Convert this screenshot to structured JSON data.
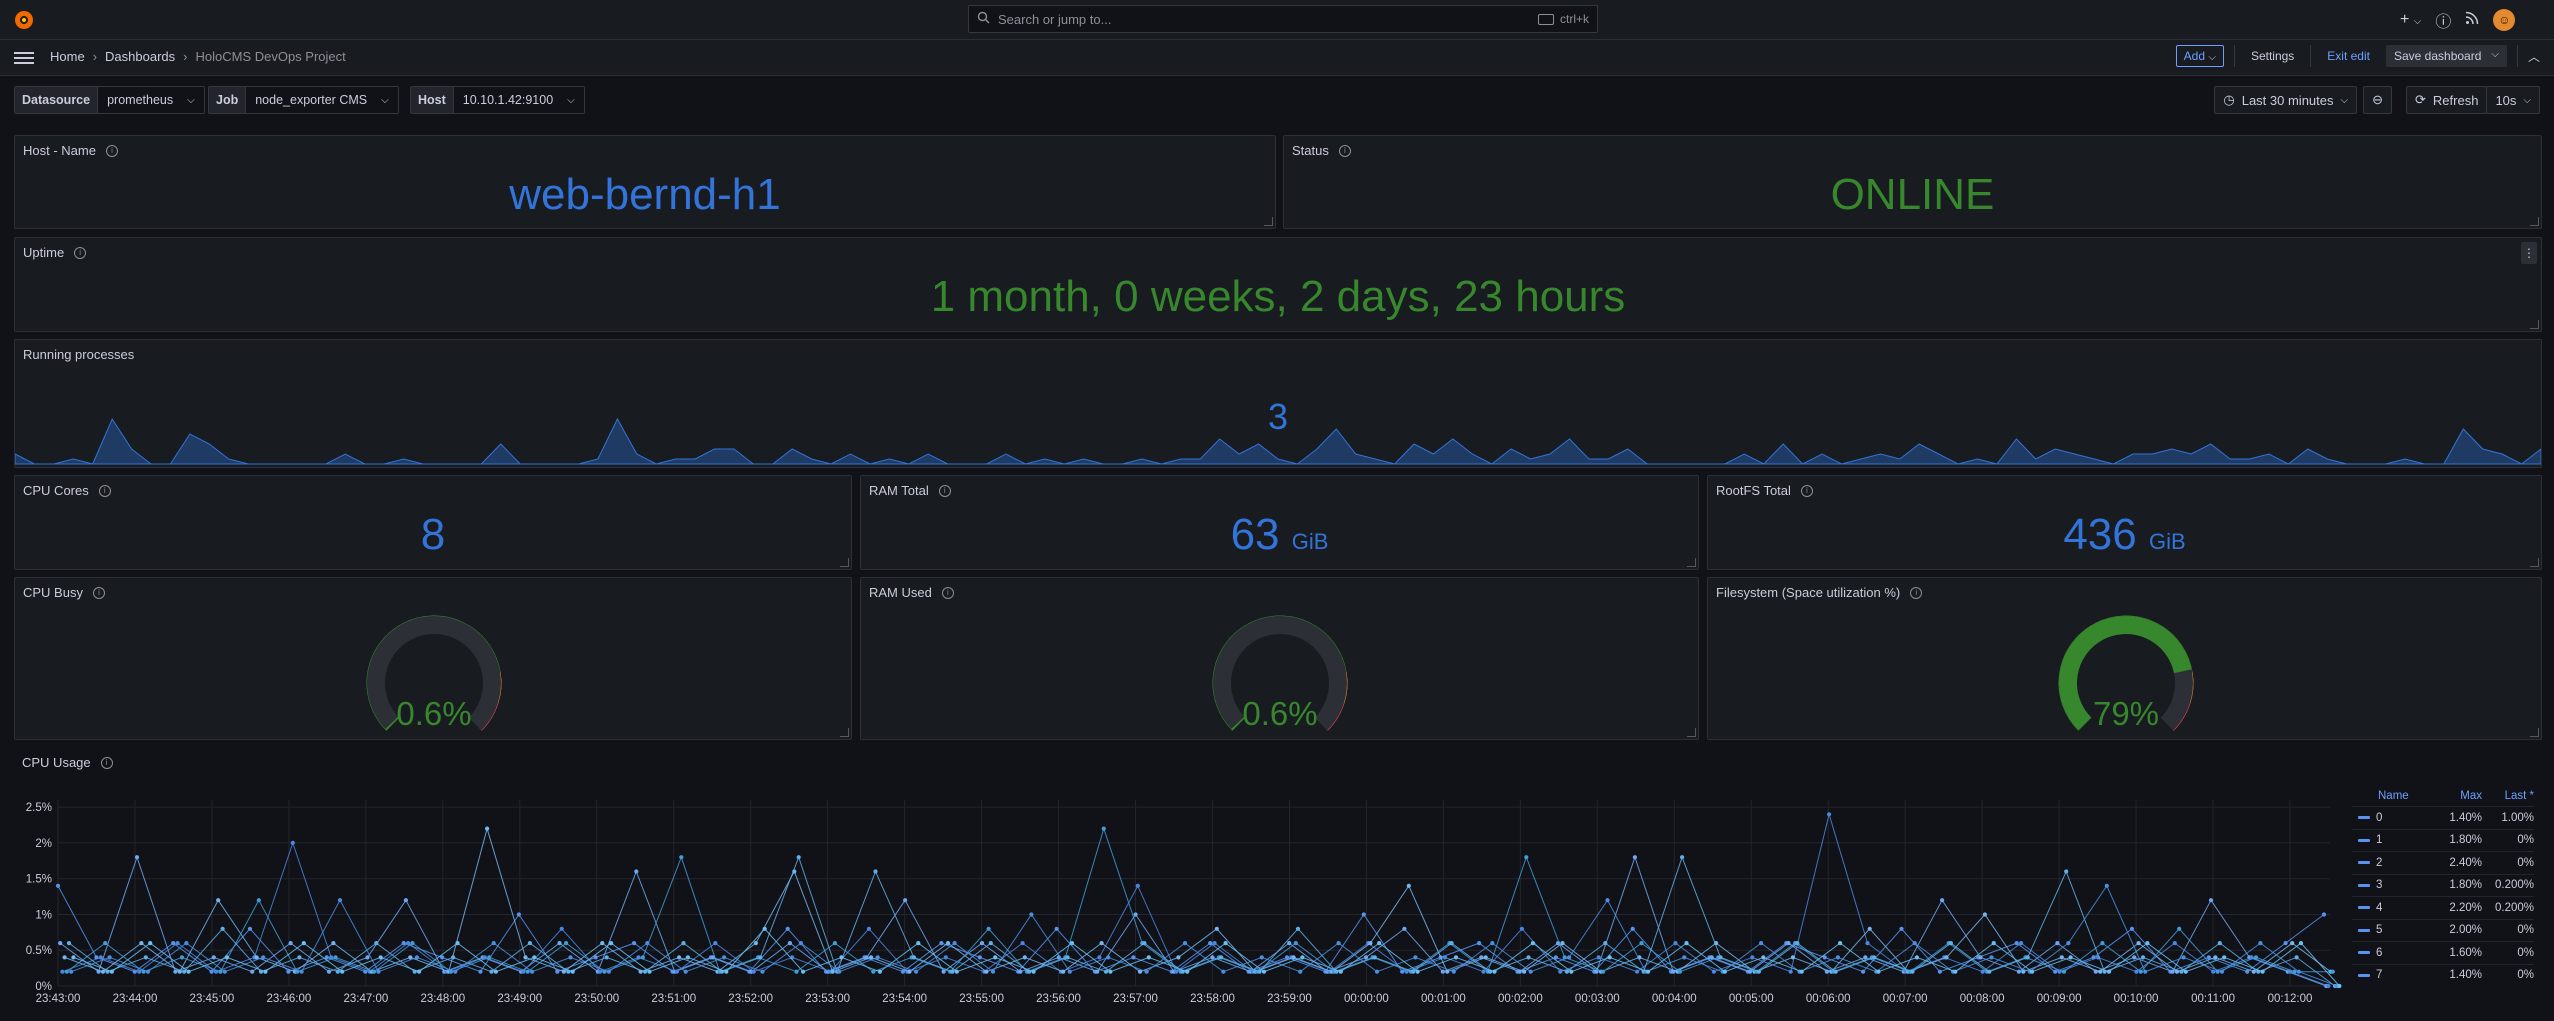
{
  "topbar": {
    "search_placeholder": "Search or jump to...",
    "search_shortcut": "ctrl+k",
    "plus_label": "+",
    "user_initial": "☺"
  },
  "breadcrumb": {
    "home": "Home",
    "dashboards": "Dashboards",
    "current": "HoloCMS DevOps Project"
  },
  "actions": {
    "add": "Add",
    "settings": "Settings",
    "exit_edit": "Exit edit",
    "save": "Save dashboard"
  },
  "variables": [
    {
      "label": "Datasource",
      "value": "prometheus"
    },
    {
      "label": "Job",
      "value": "node_exporter CMS"
    },
    {
      "label": "Host",
      "value": "10.10.1.42:9100"
    }
  ],
  "time": {
    "range": "Last 30 minutes",
    "refresh": "Refresh",
    "interval": "10s"
  },
  "panels": {
    "hostname": {
      "title": "Host - Name",
      "value": "web-bernd-h1"
    },
    "status": {
      "title": "Status",
      "value": "ONLINE"
    },
    "uptime": {
      "title": "Uptime",
      "value": "1 month, 0 weeks, 2 days, 23 hours"
    },
    "processes": {
      "title": "Running processes",
      "value": "3",
      "sparkline": [
        0.2,
        0,
        0,
        0.1,
        0,
        0.9,
        0.3,
        0,
        0,
        0.6,
        0.4,
        0.1,
        0,
        0,
        0,
        0,
        0,
        0.2,
        0,
        0,
        0.1,
        0,
        0,
        0,
        0,
        0.4,
        0,
        0,
        0,
        0,
        0.1,
        0.9,
        0.2,
        0,
        0.1,
        0.1,
        0.3,
        0.3,
        0,
        0,
        0.3,
        0.1,
        0,
        0.2,
        0,
        0.1,
        0,
        0.2,
        0,
        0,
        0,
        0.2,
        0,
        0.1,
        0,
        0.1,
        0,
        0,
        0.1,
        0,
        0.1,
        0.1,
        0.5,
        0.2,
        0.4,
        0.1,
        0,
        0.3,
        0.7,
        0.2,
        0.1,
        0,
        0.4,
        0.2,
        0.5,
        0.2,
        0,
        0.3,
        0.1,
        0.2,
        0.5,
        0.1,
        0.1,
        0.3,
        0,
        0,
        0,
        0,
        0,
        0.2,
        0,
        0.4,
        0,
        0.2,
        0,
        0.1,
        0.2,
        0.1,
        0.4,
        0.2,
        0,
        0.1,
        0,
        0.5,
        0.1,
        0.3,
        0.2,
        0.1,
        0,
        0.2,
        0.2,
        0.3,
        0.2,
        0.4,
        0.1,
        0.1,
        0.2,
        0,
        0.3,
        0.1,
        0,
        0,
        0,
        0.1,
        0,
        0,
        0.7,
        0.3,
        0.2,
        0,
        0.3
      ]
    },
    "cpu_cores": {
      "title": "CPU Cores",
      "value": "8",
      "unit": ""
    },
    "ram_total": {
      "title": "RAM Total",
      "value": "63",
      "unit": "GiB"
    },
    "rootfs_total": {
      "title": "RootFS Total",
      "value": "436",
      "unit": "GiB"
    },
    "cpu_busy": {
      "title": "CPU Busy",
      "value": "0.6%",
      "percent": 0.6
    },
    "ram_used": {
      "title": "RAM Used",
      "value": "0.6%",
      "percent": 0.6
    },
    "fs_used": {
      "title": "Filesystem (Space utilization %)",
      "value": "79%",
      "percent": 79
    },
    "cpu_usage": {
      "title": "CPU Usage"
    }
  },
  "colors": {
    "accent": "#6e9fff",
    "stat_blue": "#3274d9",
    "stat_green": "#37872d",
    "gauge_green": "#37872d",
    "gauge_orange": "#ff9830",
    "gauge_red": "#f2495c",
    "series": "#5794f2"
  },
  "chart_data": {
    "type": "line",
    "title": "CPU Usage",
    "ylim": [
      0,
      2.6
    ],
    "y_ticks": [
      "0%",
      "0.5%",
      "1%",
      "1.5%",
      "2%",
      "2.5%"
    ],
    "x_ticks": [
      "23:43:00",
      "23:44:00",
      "23:45:00",
      "23:46:00",
      "23:47:00",
      "23:48:00",
      "23:49:00",
      "23:50:00",
      "23:51:00",
      "23:52:00",
      "23:53:00",
      "23:54:00",
      "23:55:00",
      "23:56:00",
      "23:57:00",
      "23:58:00",
      "23:59:00",
      "00:00:00",
      "00:01:00",
      "00:02:00",
      "00:03:00",
      "00:04:00",
      "00:05:00",
      "00:06:00",
      "00:07:00",
      "00:08:00",
      "00:09:00",
      "00:10:00",
      "00:11:00",
      "00:12:00"
    ],
    "grid": true,
    "legend_placement": "right",
    "legend": {
      "headers": [
        "Name",
        "Max",
        "Last *"
      ],
      "rows": [
        {
          "name": "0",
          "max": "1.40%",
          "last": "1.00%"
        },
        {
          "name": "1",
          "max": "1.80%",
          "last": "0%"
        },
        {
          "name": "2",
          "max": "2.40%",
          "last": "0%"
        },
        {
          "name": "3",
          "max": "1.80%",
          "last": "0.200%"
        },
        {
          "name": "4",
          "max": "2.20%",
          "last": "0.200%"
        },
        {
          "name": "5",
          "max": "2.00%",
          "last": "0%"
        },
        {
          "name": "6",
          "max": "1.60%",
          "last": "0%"
        },
        {
          "name": "7",
          "max": "1.40%",
          "last": "0%"
        }
      ]
    },
    "series": [
      {
        "name": "0",
        "values": [
          1.4,
          0.4,
          0.2,
          0.6,
          0.2,
          0.8,
          0.2,
          0.4,
          0.2,
          0.6,
          0.4,
          0.2,
          1.0,
          0.2,
          0.4,
          0.6,
          0.2,
          0.4,
          0.2,
          0.8,
          0.2,
          0.4,
          0.2,
          0.6,
          0.4,
          0.2,
          0.8,
          0.2,
          0.4,
          0.2,
          0.6,
          0.2,
          0.4,
          0.2,
          1.0,
          0.2,
          0.4,
          0.6,
          0.2,
          0.4,
          0.2,
          0.8,
          0.2,
          0.4,
          0.2,
          0.6,
          0.4,
          0.2,
          0.8,
          0.2,
          0.4,
          0.6,
          0.2,
          0.4,
          0.8,
          0.2,
          0.4,
          0.2,
          0.6,
          1.0
        ]
      },
      {
        "name": "1",
        "values": [
          0.6,
          0.2,
          1.8,
          0.2,
          0.4,
          0.2,
          0.6,
          0.2,
          0.4,
          1.2,
          0.2,
          0.4,
          0.2,
          0.6,
          0.2,
          1.6,
          0.2,
          0.4,
          0.2,
          0.6,
          0.2,
          0.4,
          1.2,
          0.2,
          0.6,
          0.2,
          0.4,
          0.2,
          1.0,
          0.2,
          0.4,
          0.2,
          0.6,
          0.2,
          0.4,
          0.8,
          0.2,
          0.4,
          0.2,
          0.6,
          0.2,
          1.8,
          0.2,
          0.4,
          0.2,
          0.6,
          0.2,
          0.4,
          0.2,
          1.2,
          0.4,
          0.2,
          0.6,
          0.2,
          0.4,
          0.2,
          1.2,
          0.4,
          0.2,
          0
        ]
      },
      {
        "name": "2",
        "values": [
          0.2,
          0.4,
          0.2,
          0.6,
          0.2,
          0.4,
          2.0,
          0.4,
          0.2,
          0.6,
          0.2,
          0.4,
          0.2,
          0.8,
          0.2,
          0.4,
          0.2,
          0.6,
          0.2,
          0.4,
          0.2,
          0.8,
          0.2,
          0.4,
          0.2,
          0.6,
          0.2,
          0.4,
          1.4,
          0.2,
          0.6,
          0.2,
          0.4,
          0.2,
          0.6,
          0.2,
          0.4,
          0.2,
          0.8,
          0.2,
          0.4,
          0.2,
          0.6,
          0.2,
          0.4,
          0.2,
          2.4,
          0.6,
          0.2,
          0.4,
          0.2,
          0.6,
          0.2,
          0.4,
          0.2,
          0.6,
          0.2,
          0.4,
          0.2,
          0
        ]
      },
      {
        "name": "3",
        "values": [
          0.4,
          0.2,
          0.6,
          0.2,
          1.2,
          0.4,
          0.2,
          0.6,
          0.2,
          0.4,
          0.2,
          2.2,
          0.4,
          0.2,
          0.6,
          0.2,
          0.4,
          0.2,
          0.6,
          1.6,
          0.2,
          0.4,
          0.2,
          0.6,
          0.2,
          0.4,
          0.2,
          0.6,
          0.2,
          0.4,
          0.8,
          0.2,
          0.4,
          0.2,
          0.6,
          1.4,
          0.2,
          0.4,
          0.2,
          0.6,
          0.2,
          0.4,
          0.2,
          0.6,
          0.2,
          0.4,
          0.2,
          0.8,
          0.2,
          0.4,
          1.0,
          0.2,
          0.4,
          0.2,
          0.6,
          0.2,
          0.4,
          0.2,
          0.6,
          0.2
        ]
      },
      {
        "name": "4",
        "values": [
          0.2,
          0.6,
          0.2,
          0.4,
          0.2,
          1.2,
          0.2,
          0.4,
          0.2,
          0.6,
          0.2,
          0.4,
          0.2,
          0.6,
          0.2,
          0.4,
          1.8,
          0.2,
          0.4,
          0.2,
          0.6,
          0.2,
          0.4,
          0.2,
          0.8,
          0.2,
          0.4,
          2.2,
          0.6,
          0.2,
          0.4,
          0.2,
          0.6,
          0.2,
          0.4,
          0.2,
          0.6,
          0.2,
          1.8,
          0.4,
          0.2,
          0.6,
          0.2,
          0.4,
          0.2,
          0.6,
          0.2,
          0.4,
          0.2,
          0.6,
          0.2,
          0.4,
          0.2,
          0.6,
          0.2,
          0.8,
          0.2,
          0.4,
          0.2,
          0.2
        ]
      },
      {
        "name": "5",
        "values": [
          0.6,
          0.2,
          0.4,
          0.2,
          0.8,
          0.2,
          0.4,
          0.2,
          0.6,
          0.2,
          0.4,
          0.2,
          0.6,
          0.2,
          0.4,
          0.2,
          0.6,
          0.2,
          0.4,
          1.8,
          0.2,
          1.6,
          0.4,
          0.2,
          0.6,
          0.2,
          0.4,
          0.2,
          0.6,
          0.2,
          0.4,
          0.2,
          0.8,
          0.2,
          0.4,
          0.2,
          0.6,
          0.2,
          0.4,
          0.2,
          0.6,
          0.2,
          1.8,
          0.4,
          0.2,
          0.6,
          0.2,
          0.4,
          0.2,
          0.6,
          0.2,
          0.4,
          1.6,
          0.2,
          0.4,
          0.2,
          0.6,
          0.2,
          0.4,
          0
        ]
      },
      {
        "name": "6",
        "values": [
          0.2,
          0.4,
          0.2,
          0.6,
          0.2,
          0.4,
          0.2,
          1.2,
          0.2,
          0.4,
          0.2,
          0.6,
          0.2,
          0.4,
          0.2,
          0.6,
          0.2,
          0.4,
          0.2,
          0.6,
          0.2,
          0.4,
          0.2,
          0.6,
          0.2,
          1.0,
          0.2,
          0.4,
          0.2,
          0.6,
          0.2,
          0.4,
          0.2,
          0.6,
          0.2,
          0.4,
          0.2,
          0.6,
          0.2,
          0.4,
          1.2,
          0.2,
          0.4,
          0.2,
          0.6,
          0.2,
          0.4,
          0.2,
          0.6,
          0.2,
          0.4,
          0.2,
          0.6,
          1.4,
          0.2,
          0.4,
          0.2,
          0.6,
          0.2,
          0
        ]
      },
      {
        "name": "7",
        "values": [
          0.4,
          0.2,
          0.6,
          0.2,
          0.4,
          0.2,
          0.6,
          0.2,
          0.4,
          0.2,
          0.6,
          0.2,
          0.4,
          0.2,
          0.6,
          0.2,
          0.4,
          0.2,
          0.8,
          0.2,
          0.4,
          0.2,
          0.6,
          0.2,
          0.4,
          0.2,
          0.6,
          0.2,
          0.4,
          0.2,
          0.6,
          0.2,
          0.4,
          0.2,
          0.6,
          0.2,
          0.4,
          0.2,
          0.6,
          0.2,
          0.4,
          0.2,
          0.6,
          0.2,
          0.4,
          0.2,
          0.6,
          0.2,
          0.4,
          0.2,
          0.6,
          0.2,
          0.4,
          0.2,
          0.6,
          0.2,
          0.4,
          0.2,
          0.6,
          0
        ]
      }
    ]
  }
}
